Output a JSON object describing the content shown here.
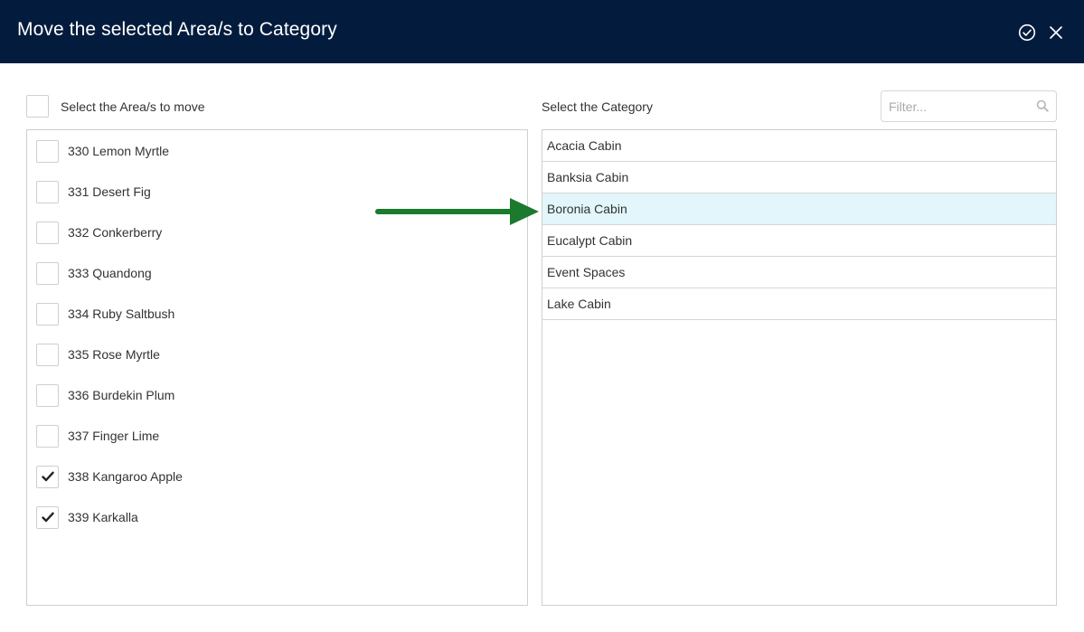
{
  "dialog": {
    "title": "Move the selected Area/s to Category",
    "confirm_icon": "check-circle-icon",
    "close_icon": "close-icon"
  },
  "left": {
    "heading": "Select the Area/s to move",
    "select_all_checked": false,
    "areas": [
      {
        "label": "330 Lemon Myrtle",
        "checked": false
      },
      {
        "label": "331 Desert Fig",
        "checked": false
      },
      {
        "label": "332 Conkerberry",
        "checked": false
      },
      {
        "label": "333 Quandong",
        "checked": false
      },
      {
        "label": "334 Ruby Saltbush",
        "checked": false
      },
      {
        "label": "335 Rose Myrtle",
        "checked": false
      },
      {
        "label": "336 Burdekin Plum",
        "checked": false
      },
      {
        "label": "337 Finger Lime",
        "checked": false
      },
      {
        "label": "338 Kangaroo Apple",
        "checked": true
      },
      {
        "label": "339 Karkalla",
        "checked": true
      }
    ]
  },
  "right": {
    "heading": "Select the Category",
    "filter_placeholder": "Filter...",
    "filter_value": "",
    "filter_icon": "search-icon",
    "categories": [
      {
        "label": "Acacia Cabin",
        "selected": false
      },
      {
        "label": "Banksia Cabin",
        "selected": false
      },
      {
        "label": "Boronia Cabin",
        "selected": true
      },
      {
        "label": "Eucalypt Cabin",
        "selected": false
      },
      {
        "label": "Event Spaces",
        "selected": false
      },
      {
        "label": "Lake Cabin",
        "selected": false
      }
    ]
  },
  "annotation": {
    "arrow_icon": "arrow-right-icon",
    "arrow_color": "#1b7a2d"
  },
  "colors": {
    "header_bg": "#031c3d",
    "selected_row_bg": "#e2f6fb"
  }
}
